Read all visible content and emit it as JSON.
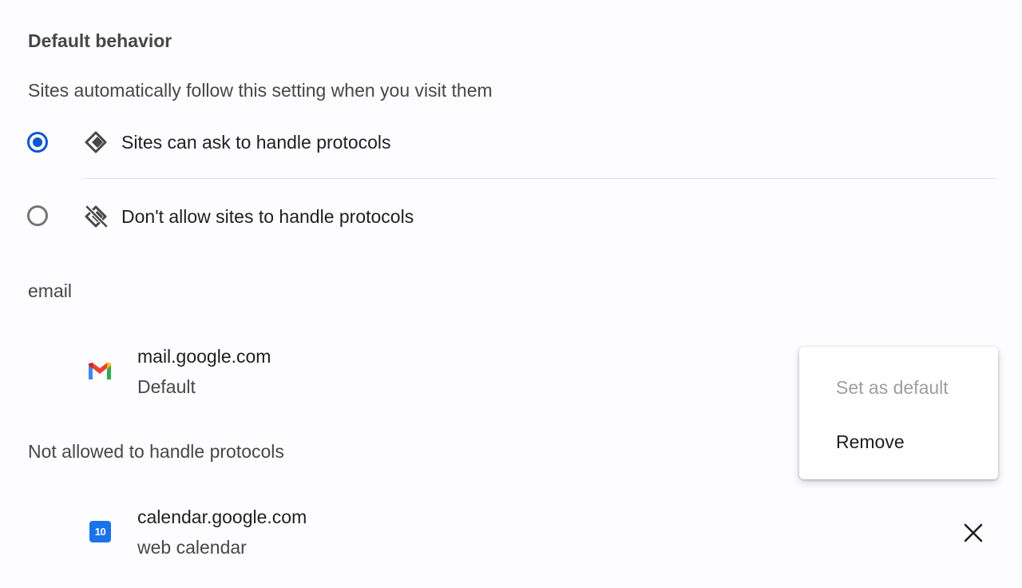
{
  "default_behavior": {
    "heading": "Default behavior",
    "description": "Sites automatically follow this setting when you visit them",
    "options": [
      {
        "label": "Sites can ask to handle protocols",
        "checked": true,
        "icon": "protocol-handler-icon"
      },
      {
        "label": "Don't allow sites to handle protocols",
        "checked": false,
        "icon": "protocol-handler-off-icon"
      }
    ]
  },
  "email_group": {
    "label": "email",
    "site": {
      "name": "mail.google.com",
      "subtitle": "Default",
      "icon": "gmail-icon"
    }
  },
  "blocked_group": {
    "label": "Not allowed to handle protocols",
    "site": {
      "name": "calendar.google.com",
      "subtitle": "web calendar",
      "icon": "google-calendar-icon",
      "icon_text": "10"
    }
  },
  "context_menu": {
    "items": [
      {
        "label": "Set as default",
        "disabled": true
      },
      {
        "label": "Remove",
        "disabled": false
      }
    ]
  },
  "colors": {
    "accent": "#0b57d0",
    "calendar_blue": "#1a73e8"
  }
}
